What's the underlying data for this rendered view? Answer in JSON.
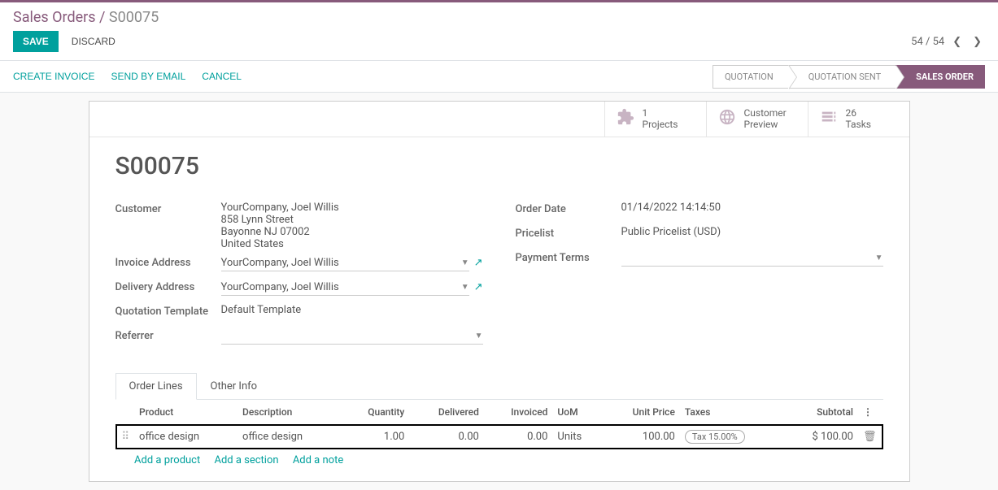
{
  "breadcrumb": {
    "parent": "Sales Orders",
    "sep": " / ",
    "current": "S00075"
  },
  "buttons": {
    "save": "SAVE",
    "discard": "DISCARD"
  },
  "pager": {
    "text": "54 / 54"
  },
  "actions": {
    "create_invoice": "CREATE INVOICE",
    "send_email": "SEND BY EMAIL",
    "cancel": "CANCEL"
  },
  "status": {
    "quotation": "QUOTATION",
    "quotation_sent": "QUOTATION SENT",
    "sales_order": "SALES ORDER"
  },
  "stats": {
    "projects": {
      "num": "1",
      "label": "Projects"
    },
    "preview": {
      "top": "Customer",
      "bottom": "Preview"
    },
    "tasks": {
      "num": "26",
      "label": "Tasks"
    }
  },
  "order": {
    "name": "S00075",
    "labels": {
      "customer": "Customer",
      "invoice_address": "Invoice Address",
      "delivery_address": "Delivery Address",
      "quotation_template": "Quotation Template",
      "referrer": "Referrer",
      "order_date": "Order Date",
      "pricelist": "Pricelist",
      "payment_terms": "Payment Terms"
    },
    "customer_name": "YourCompany, Joel Willis",
    "customer_addr1": "858 Lynn Street",
    "customer_addr2": "Bayonne NJ 07002",
    "customer_country": "United States",
    "invoice_address": "YourCompany, Joel Willis",
    "delivery_address": "YourCompany, Joel Willis",
    "quotation_template": "Default Template",
    "order_date": "01/14/2022 14:14:50",
    "pricelist": "Public Pricelist (USD)"
  },
  "tabs": {
    "order_lines": "Order Lines",
    "other_info": "Other Info"
  },
  "table": {
    "headers": {
      "product": "Product",
      "description": "Description",
      "quantity": "Quantity",
      "delivered": "Delivered",
      "invoiced": "Invoiced",
      "uom": "UoM",
      "unit_price": "Unit Price",
      "taxes": "Taxes",
      "subtotal": "Subtotal"
    },
    "row": {
      "product": "office design",
      "description": "office design",
      "quantity": "1.00",
      "delivered": "0.00",
      "invoiced": "0.00",
      "uom": "Units",
      "unit_price": "100.00",
      "tax": "Tax 15.00%",
      "subtotal": "$ 100.00"
    },
    "adders": {
      "product": "Add a product",
      "section": "Add a section",
      "note": "Add a note"
    }
  }
}
